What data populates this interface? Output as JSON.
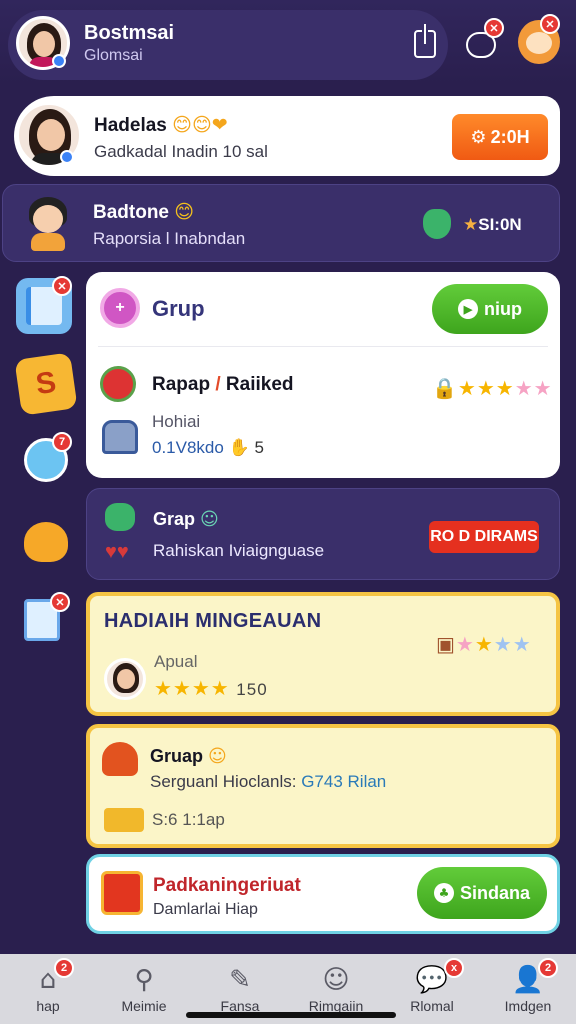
{
  "header": {
    "name": "Bostmsai",
    "subtitle": "Glomsai",
    "share_icon": "share-icon",
    "cloud_badge": "",
    "mascot_icon": "monkey-mascot-icon"
  },
  "profile_card": {
    "title": "Hadelas",
    "emojis": "😊😊❤",
    "subtitle": "Gadkadal Inadin 10 sal",
    "button_label": "2:0H"
  },
  "friend_card": {
    "title": "Badtone",
    "emoji": "😊",
    "subtitle": "Raporsia l Inabndan",
    "status": "SI:0N"
  },
  "group_card": {
    "title": "Grup",
    "join_label": "niup",
    "ranked_title": "Rapap",
    "ranked_label": "Raiiked",
    "rating": {
      "gold": 3,
      "total": 5
    },
    "sub_label": "Hohiai",
    "sub_value": "0.1V8kdo",
    "sub_count": "5"
  },
  "group2_card": {
    "title": "Grap",
    "subtitle": "Rahiskan Iviaignguase",
    "button_label": "RO D DIRAMS"
  },
  "weekly_card": {
    "title": "HADIAIH MINGEAUAN",
    "label": "Apual",
    "score": "150",
    "rating": {
      "gold": 2,
      "total": 4
    }
  },
  "group3_card": {
    "title": "Gruap",
    "subtitle_prefix": "Serguanl Hioclanls:",
    "subtitle_value": "G743 Rilan",
    "extra": "S:6 1:1ap"
  },
  "reward_card": {
    "title": "Padkaningeriuat",
    "subtitle": "Damlarlai Hiap",
    "button_label": "Sindana"
  },
  "bottom_nav": [
    {
      "label": "hap",
      "icon": "home-icon",
      "badge": "2"
    },
    {
      "label": "Meimie",
      "icon": "search-icon",
      "badge": ""
    },
    {
      "label": "Fansa",
      "icon": "edit-icon",
      "badge": ""
    },
    {
      "label": "Rimgaiin",
      "icon": "bot-face-icon",
      "badge": ""
    },
    {
      "label": "Rlomal",
      "icon": "chat-icon",
      "badge": "x"
    },
    {
      "label": "Imdgen",
      "icon": "person-icon",
      "badge": "2"
    }
  ],
  "colors": {
    "background": "#2a1f4e",
    "card_dark": "#3a2f6a",
    "orange": "#f05a13",
    "green": "#3ea51d",
    "red": "#e5301f",
    "cream": "#fbf5c8",
    "gold_border": "#f5c443"
  }
}
